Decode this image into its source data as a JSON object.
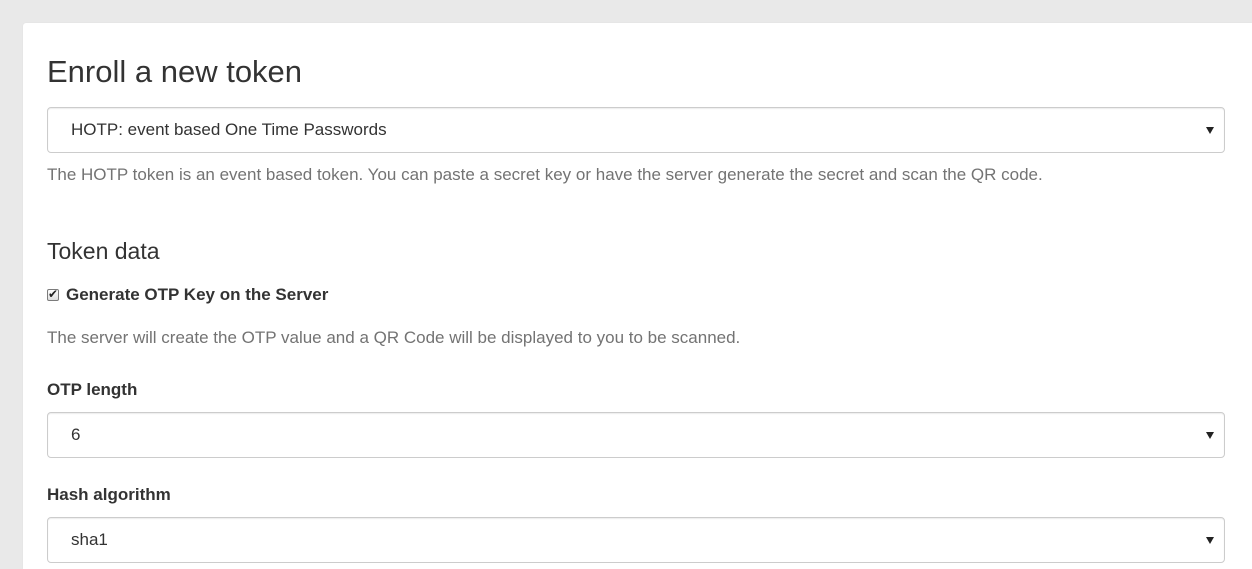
{
  "page": {
    "title": "Enroll a new token"
  },
  "token_type_select": {
    "value": "HOTP: event based One Time Passwords"
  },
  "token_description": "The HOTP token is an event based token. You can paste a secret key or have the server generate the secret and scan the QR code.",
  "token_data": {
    "heading": "Token data",
    "generate_key": {
      "label": "Generate OTP Key on the Server",
      "checked": true,
      "description": "The server will create the OTP value and a QR Code will be displayed to you to be scanned."
    },
    "otp_length": {
      "label": "OTP length",
      "value": "6"
    },
    "hash_algorithm": {
      "label": "Hash algorithm",
      "value": "sha1"
    }
  },
  "icons": {
    "checkbox_checked": "check-icon",
    "select_caret": "caret-down-icon"
  }
}
